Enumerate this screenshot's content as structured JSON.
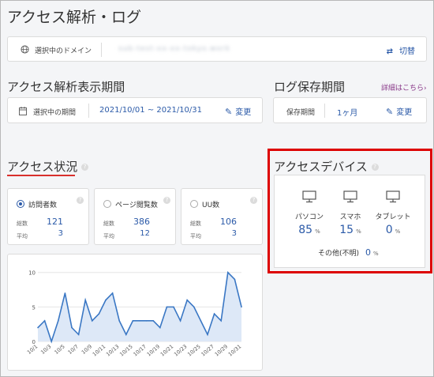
{
  "page_title": "アクセス解析・ログ",
  "domain_bar": {
    "label": "選択中のドメイン",
    "domain_value": "sub-test-xx-xx-tokyo.work",
    "switch_label": "切替"
  },
  "period_section": {
    "title": "アクセス解析表示期間",
    "label": "選択中の期間",
    "value": "2021/10/01 ~ 2021/10/31",
    "change_label": "変更"
  },
  "log_section": {
    "title": "ログ保存期間",
    "link": "詳細はこちら›",
    "label": "保存期間",
    "value": "1ヶ月",
    "change_label": "変更"
  },
  "access_status": {
    "title": "アクセス状況",
    "help": "?",
    "cards": [
      {
        "title": "訪問者数",
        "selected": true,
        "total_label": "総数",
        "total": "121",
        "avg_label": "平均",
        "avg": "3"
      },
      {
        "title": "ページ閲覧数",
        "selected": false,
        "total_label": "総数",
        "total": "386",
        "avg_label": "平均",
        "avg": "12"
      },
      {
        "title": "UU数",
        "selected": false,
        "total_label": "総数",
        "total": "106",
        "avg_label": "平均",
        "avg": "3"
      }
    ]
  },
  "chart_data": {
    "type": "area",
    "x": [
      "10/1",
      "10/2",
      "10/3",
      "10/4",
      "10/5",
      "10/6",
      "10/7",
      "10/8",
      "10/9",
      "10/10",
      "10/11",
      "10/12",
      "10/13",
      "10/14",
      "10/15",
      "10/16",
      "10/17",
      "10/18",
      "10/19",
      "10/20",
      "10/21",
      "10/22",
      "10/23",
      "10/24",
      "10/25",
      "10/26",
      "10/27",
      "10/28",
      "10/29",
      "10/30",
      "10/31"
    ],
    "tick_labels": [
      "10/1",
      "10/3",
      "10/5",
      "10/7",
      "10/9",
      "10/11",
      "10/13",
      "10/15",
      "10/17",
      "10/19",
      "10/21",
      "10/23",
      "10/25",
      "10/27",
      "10/29",
      "10/31"
    ],
    "values": [
      2,
      3,
      0,
      3,
      7,
      2,
      1,
      6,
      3,
      4,
      6,
      7,
      3,
      1,
      3,
      3,
      3,
      3,
      2,
      5,
      5,
      3,
      6,
      5,
      3,
      1,
      4,
      3,
      10,
      9,
      5
    ],
    "yticks": [
      0,
      5,
      10
    ],
    "ylim": [
      0,
      11
    ],
    "grid": true,
    "line_color": "#3a77c4",
    "fill_color": "#dde8f7"
  },
  "devices": {
    "title": "アクセスデバイス",
    "help": "?",
    "items": [
      {
        "name": "パソコン",
        "value": "85",
        "unit": "%",
        "icon": "monitor-icon"
      },
      {
        "name": "スマホ",
        "value": "15",
        "unit": "%",
        "icon": "monitor-icon"
      },
      {
        "name": "タブレット",
        "value": "0",
        "unit": "%",
        "icon": "monitor-icon"
      }
    ],
    "other_label": "その他(不明)",
    "other_value": "0",
    "other_unit": "%"
  },
  "colors": {
    "accent": "#2b5aa8",
    "highlight": "#dd0000",
    "underline": "#d9302c"
  }
}
